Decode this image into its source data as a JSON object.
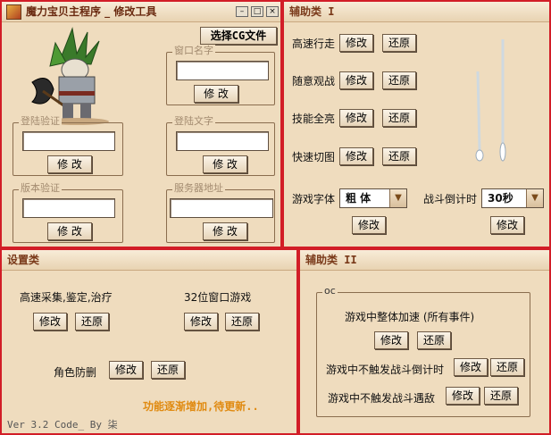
{
  "window": {
    "title": "魔力宝贝主程序 _ 修改工具",
    "select_cg_button": "选择CG文件",
    "ctrl_minimize": "–",
    "ctrl_maximize": "□",
    "ctrl_close": "×"
  },
  "left_panel": {
    "window_name": {
      "label": "窗口名字",
      "value": "",
      "button": "修 改"
    },
    "login_verify": {
      "label": "登陆验证",
      "value": "",
      "button": "修 改"
    },
    "login_text": {
      "label": "登陆文字",
      "value": "",
      "button": "修 改"
    },
    "version_verify": {
      "label": "版本验证",
      "value": "",
      "button": "修 改"
    },
    "server_address": {
      "label": "服务器地址",
      "value": "",
      "button": "修 改"
    }
  },
  "aux1": {
    "title": "辅助类 I",
    "rows": [
      {
        "label": "高速行走",
        "modify": "修改",
        "restore": "还原"
      },
      {
        "label": "随意观战",
        "modify": "修改",
        "restore": "还原"
      },
      {
        "label": "技能全亮",
        "modify": "修改",
        "restore": "还原"
      },
      {
        "label": "快速切图",
        "modify": "修改",
        "restore": "还原"
      }
    ],
    "font_label": "游戏字体",
    "font_value": "粗 体",
    "font_button": "修改",
    "countdown_label": "战斗倒计时",
    "countdown_value": "30秒",
    "countdown_button": "修改",
    "dropdown_arrow": "▼"
  },
  "settings": {
    "title": "设置类",
    "gather": {
      "label": "高速采集,鉴定,治疗",
      "modify": "修改",
      "restore": "还原"
    },
    "window32": {
      "label": "32位窗口游戏",
      "modify": "修改",
      "restore": "还原"
    },
    "role_protect": {
      "label": "角色防删",
      "modify": "修改",
      "restore": "还原"
    },
    "notice": "功能逐渐增加,待更新..",
    "footer": "Ver 3.2  Code_ By 柒"
  },
  "aux2": {
    "title": "辅助类 II",
    "group_label": "oc",
    "speedup": {
      "label": "游戏中整体加速 (所有事件)",
      "modify": "修改",
      "restore": "还原"
    },
    "no_countdown": {
      "label": "游戏中不触发战斗倒计时",
      "modify": "修改",
      "restore": "还原"
    },
    "no_encounter": {
      "label": "游戏中不触发战斗遇敌",
      "modify": "修改",
      "restore": "还原"
    }
  }
}
